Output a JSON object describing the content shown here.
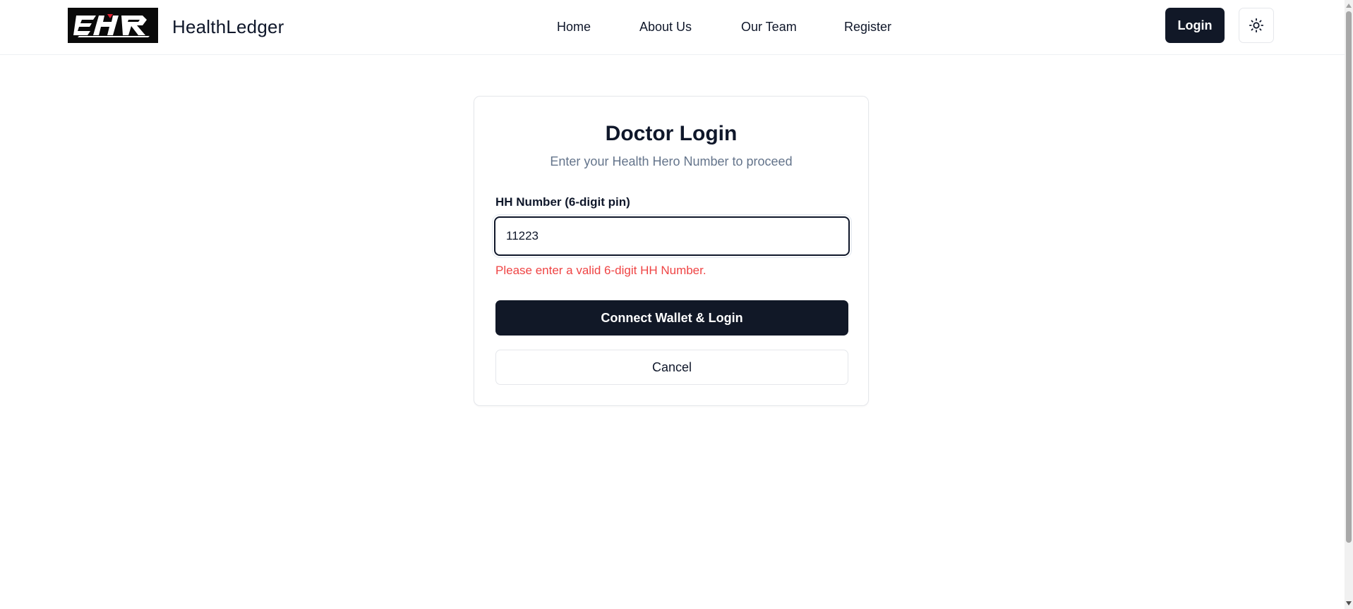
{
  "header": {
    "logo_icon": "ehr-logo-icon",
    "brand_name": "HealthLedger",
    "nav": [
      {
        "label": "Home"
      },
      {
        "label": "About Us"
      },
      {
        "label": "Our Team"
      },
      {
        "label": "Register"
      }
    ],
    "login_label": "Login",
    "theme_toggle_icon": "sun-icon"
  },
  "card": {
    "title": "Doctor Login",
    "subtitle": "Enter your Health Hero Number to proceed",
    "field_label": "HH Number (6-digit pin)",
    "field_value": "11223",
    "error": "Please enter a valid 6-digit HH Number.",
    "primary_label": "Connect Wallet & Login",
    "secondary_label": "Cancel"
  },
  "colors": {
    "primary": "#111827",
    "error": "#ef4444",
    "muted_text": "#64748b",
    "border": "#e5e7eb"
  }
}
